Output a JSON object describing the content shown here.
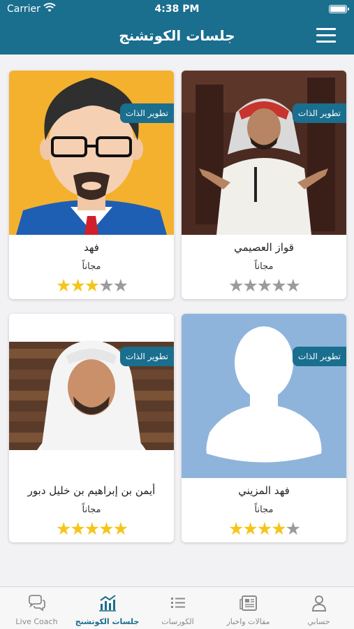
{
  "status_bar": {
    "carrier": "Carrier",
    "time": "4:38 PM"
  },
  "header": {
    "title": "جلسات الكوتشنج"
  },
  "cards": [
    {
      "name": "قواز العصيمي",
      "badge": "تطوير الذات",
      "price": "مجاناً",
      "rating": 0,
      "rating_max": 5
    },
    {
      "name": "فهد",
      "badge": "تطوير الذات",
      "price": "مجاناً",
      "rating": 3,
      "rating_max": 5
    },
    {
      "name": "فهد المزيني",
      "badge": "تطوير الذات",
      "price": "مجاناً",
      "rating": 4,
      "rating_max": 5
    },
    {
      "name": "أيمن بن إبراهيم بن خليل دبور",
      "badge": "تطوير الذات",
      "price": "مجاناً",
      "rating": 5,
      "rating_max": 5
    }
  ],
  "tabbar": {
    "tabs": [
      {
        "label": "حسابي",
        "icon": "person-icon"
      },
      {
        "label": "مقالات واخبار",
        "icon": "newspaper-icon"
      },
      {
        "label": "الكورسات",
        "icon": "list-icon"
      },
      {
        "label": "جلسات الكوتشنج",
        "icon": "chart-icon",
        "active": true
      },
      {
        "label": "Live Coach",
        "icon": "chat-bubbles-icon"
      }
    ]
  },
  "colors": {
    "primary": "#1a6e8e",
    "star_on": "#f5c518",
    "star_off": "#9b9b9b",
    "background": "#f2f2f4"
  }
}
